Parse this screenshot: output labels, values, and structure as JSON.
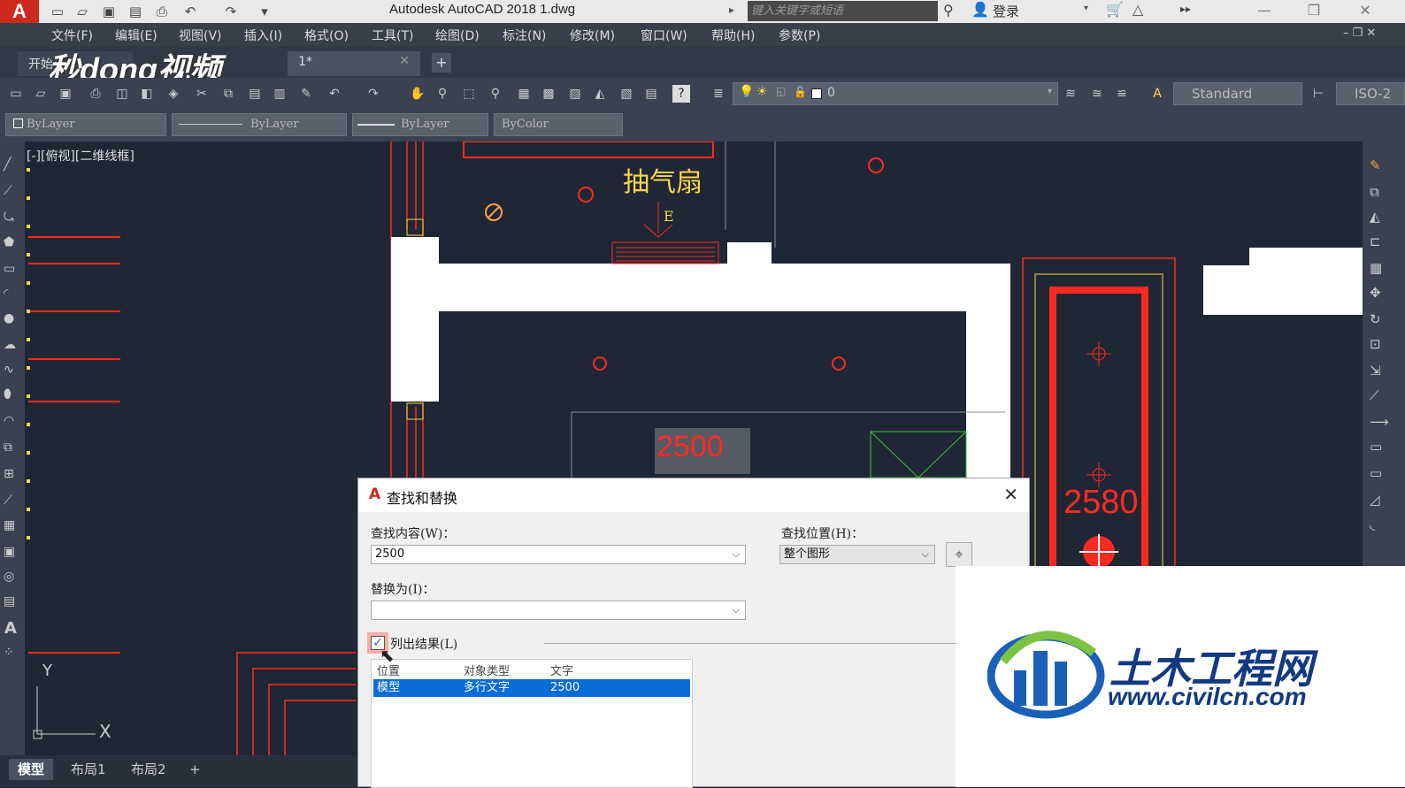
{
  "window": {
    "app_letter": "A",
    "title": "Autodesk AutoCAD 2018    1.dwg",
    "search_placeholder": "键入关键字或短语",
    "login_label": "登录"
  },
  "menu": [
    "文件(F)",
    "编辑(E)",
    "视图(V)",
    "插入(I)",
    "格式(O)",
    "工具(T)",
    "绘图(D)",
    "标注(N)",
    "修改(M)",
    "窗口(W)",
    "帮助(H)",
    "参数(P)"
  ],
  "tabs": {
    "start": "开始",
    "doc": "1*",
    "add": "+"
  },
  "watermark_top": "秒dong视频",
  "layer": {
    "value": "0",
    "text_style": "Standard",
    "dim_style": "ISO-2"
  },
  "properties": {
    "color": "ByLayer",
    "linetype": "ByLayer",
    "lineweight": "ByLayer",
    "plotstyle": "ByColor"
  },
  "viewport_label": "[-][俯视][二维线框]",
  "drawing": {
    "fan_label": "抽气扇",
    "fan_tag": "E",
    "dim1": "2500",
    "dim2": "2580",
    "ucs_x": "X",
    "ucs_y": "Y"
  },
  "dialog": {
    "title": "查找和替换",
    "find_label": "查找内容(W)：",
    "find_value": "2500",
    "where_label": "查找位置(H)：",
    "where_value": "整个图形",
    "replace_label": "替换为(I)：",
    "replace_value": "",
    "list_results_label": "列出结果(L)",
    "list_results_checked": true,
    "columns": [
      "位置",
      "对象类型",
      "文字"
    ],
    "rows": [
      [
        "模型",
        "多行文字",
        "2500"
      ]
    ]
  },
  "layouts": [
    "模型",
    "布局1",
    "布局2",
    "+"
  ],
  "watermark": {
    "title": "土木工程网",
    "url": "www.civilcn.com"
  },
  "colors": {
    "accent_red": "#ff2a1f",
    "cad_bg": "#1f2735",
    "selection": "#0a6cd8"
  }
}
